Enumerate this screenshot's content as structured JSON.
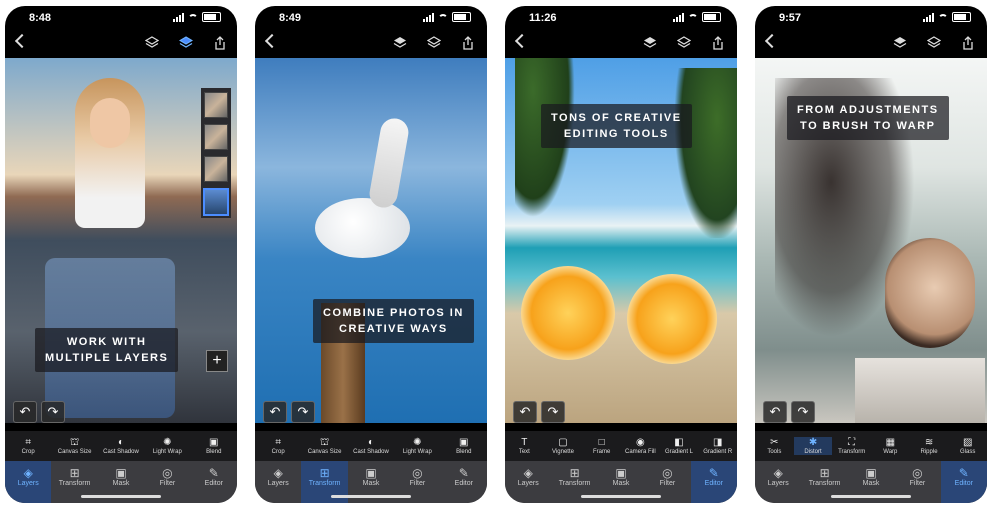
{
  "phones": [
    {
      "time": "8:48",
      "caption_line1": "Work with",
      "caption_line2": "multiple Layers",
      "tools": [
        {
          "icon": "⌗",
          "label": "Crop"
        },
        {
          "icon": "⛫",
          "label": "Canvas Size"
        },
        {
          "icon": "◐",
          "label": "Cast Shadow"
        },
        {
          "icon": "✺",
          "label": "Light Wrap"
        },
        {
          "icon": "▣",
          "label": "Blend"
        }
      ],
      "tabs": [
        "Layers",
        "Transform",
        "Mask",
        "Filter",
        "Editor"
      ],
      "active_tab": "Layers"
    },
    {
      "time": "8:49",
      "caption_line1": "Combine photos in",
      "caption_line2": "creative ways",
      "tools": [
        {
          "icon": "⌗",
          "label": "Crop"
        },
        {
          "icon": "⛫",
          "label": "Canvas Size"
        },
        {
          "icon": "◐",
          "label": "Cast Shadow"
        },
        {
          "icon": "✺",
          "label": "Light Wrap"
        },
        {
          "icon": "▣",
          "label": "Blend"
        }
      ],
      "tabs": [
        "Layers",
        "Transform",
        "Mask",
        "Filter",
        "Editor"
      ],
      "active_tab": "Transform"
    },
    {
      "time": "11:26",
      "caption_line1": "Tons of creative",
      "caption_line2": "editing tools",
      "tools": [
        {
          "icon": "T",
          "label": "Text"
        },
        {
          "icon": "▢",
          "label": "Vignette"
        },
        {
          "icon": "□",
          "label": "Frame"
        },
        {
          "icon": "◉",
          "label": "Camera Fill"
        },
        {
          "icon": "◧",
          "label": "Gradient L"
        },
        {
          "icon": "◨",
          "label": "Gradient R"
        }
      ],
      "tabs": [
        "Layers",
        "Transform",
        "Mask",
        "Filter",
        "Editor"
      ],
      "active_tab": "Editor"
    },
    {
      "time": "9:57",
      "caption_line1": "From adjustments",
      "caption_line2": "to brush to warp",
      "tools": [
        {
          "icon": "✂",
          "label": "Tools"
        },
        {
          "icon": "✱",
          "label": "Distort"
        },
        {
          "icon": "⛶",
          "label": "Transform"
        },
        {
          "icon": "▦",
          "label": "Warp"
        },
        {
          "icon": "≋",
          "label": "Ripple"
        },
        {
          "icon": "▨",
          "label": "Glass"
        }
      ],
      "tabs": [
        "Layers",
        "Transform",
        "Mask",
        "Filter",
        "Editor"
      ],
      "active_tab": "Editor"
    }
  ],
  "icons": {
    "back": "chevron-left-icon",
    "layers": "layers-icon",
    "share": "share-icon",
    "undo": "undo-icon",
    "redo": "redo-icon",
    "add": "plus-icon"
  },
  "colors": {
    "accent": "#4c8dff",
    "tab_active_bg": "#2a4677",
    "toolbar_bg": "#1b1b1d",
    "tabbar_bg": "#3c3c40"
  }
}
